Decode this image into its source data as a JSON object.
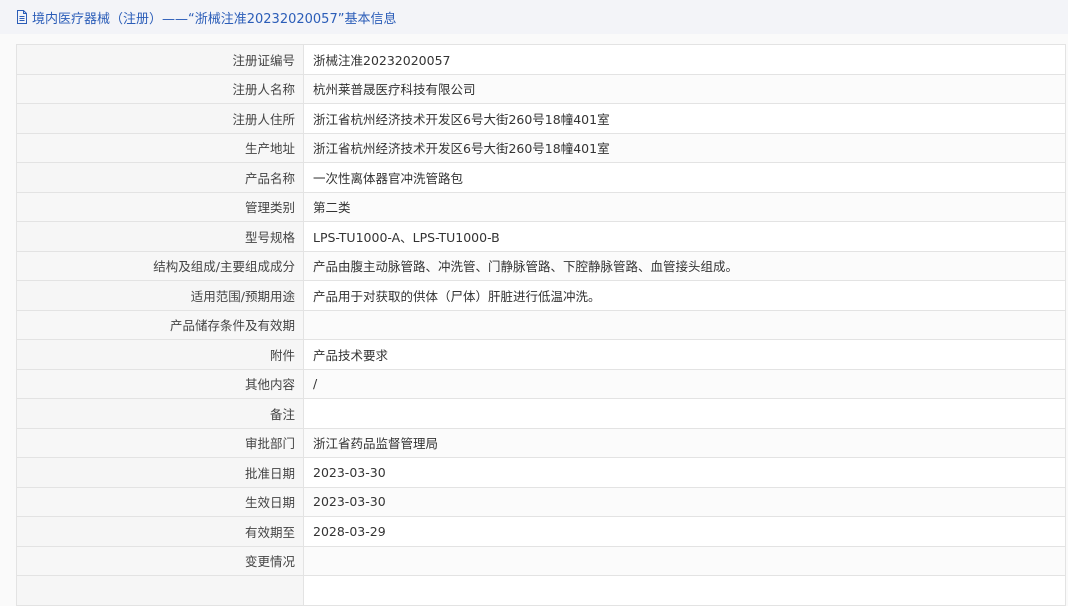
{
  "header": {
    "icon": "document-icon",
    "title": "境内医疗器械（注册）——“浙械注准20232020057”基本信息",
    "color": "#2b5db8"
  },
  "rows": [
    {
      "label": "注册证编号",
      "value": "浙械注准20232020057"
    },
    {
      "label": "注册人名称",
      "value": "杭州莱普晟医疗科技有限公司"
    },
    {
      "label": "注册人住所",
      "value": "浙江省杭州经济技术开发区6号大街260号18幢401室"
    },
    {
      "label": "生产地址",
      "value": "浙江省杭州经济技术开发区6号大街260号18幢401室"
    },
    {
      "label": "产品名称",
      "value": "一次性离体器官冲洗管路包"
    },
    {
      "label": "管理类别",
      "value": "第二类"
    },
    {
      "label": "型号规格",
      "value": "LPS-TU1000-A、LPS-TU1000-B"
    },
    {
      "label": "结构及组成/主要组成成分",
      "value": "产品由腹主动脉管路、冲洗管、门静脉管路、下腔静脉管路、血管接头组成。"
    },
    {
      "label": "适用范围/预期用途",
      "value": "产品用于对获取的供体（尸体）肝脏进行低温冲洗。"
    },
    {
      "label": "产品储存条件及有效期",
      "value": ""
    },
    {
      "label": "附件",
      "value": "产品技术要求"
    },
    {
      "label": "其他内容",
      "value": "/"
    },
    {
      "label": "备注",
      "value": ""
    },
    {
      "label": "审批部门",
      "value": "浙江省药品监督管理局"
    },
    {
      "label": "批准日期",
      "value": "2023-03-30"
    },
    {
      "label": "生效日期",
      "value": "2023-03-30"
    },
    {
      "label": "有效期至",
      "value": "2028-03-29"
    },
    {
      "label": "变更情况",
      "value": ""
    },
    {
      "label": "",
      "value": ""
    }
  ]
}
